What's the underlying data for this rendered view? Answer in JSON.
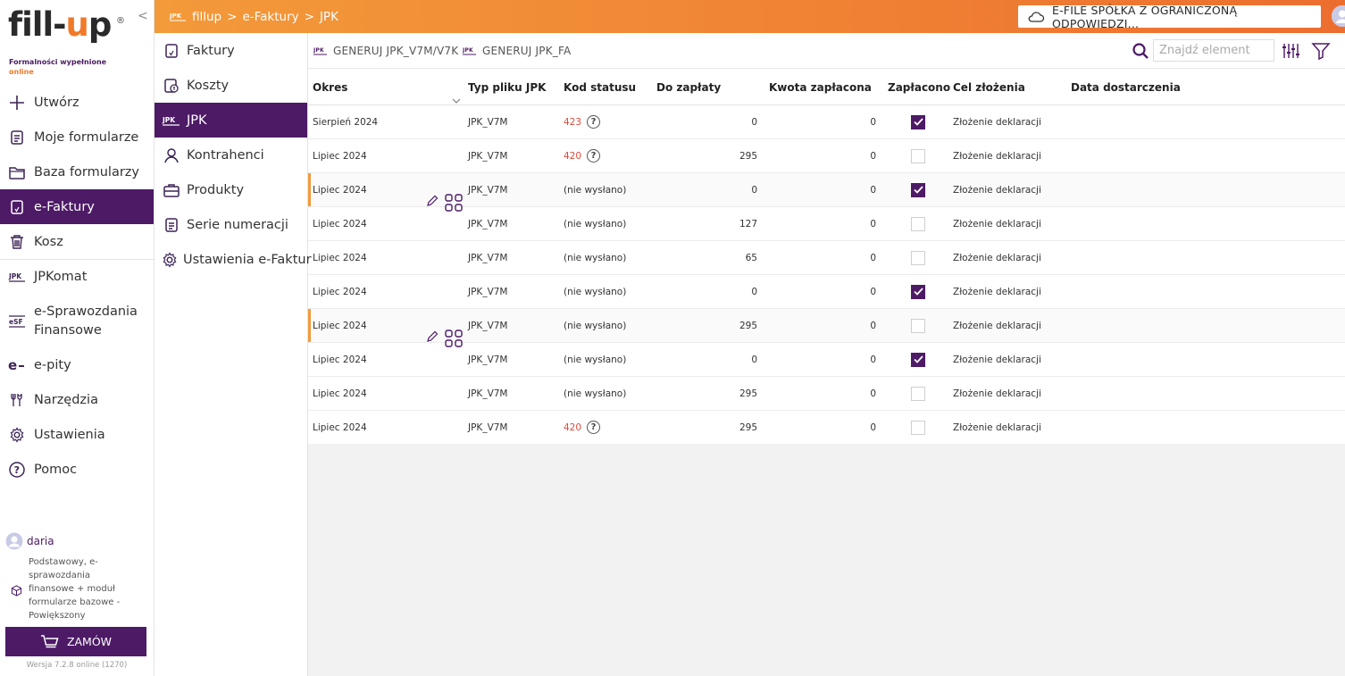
{
  "brand": {
    "logo_text_pre": "fill-",
    "logo_text_o": "u",
    "logo_text_post": "p",
    "reg": "®",
    "tagline_1": "Formalności wypełnione",
    "tagline_2": "online",
    "accent": "#f07a2a",
    "primary": "#4d1a66"
  },
  "collapse_label": "<",
  "sidebar": {
    "items": [
      {
        "label": "Utwórz",
        "icon": "plus-icon"
      },
      {
        "label": "Moje formularze",
        "icon": "document-icon"
      },
      {
        "label": "Baza formularzy",
        "icon": "folder-icon"
      },
      {
        "label": "e-Faktury",
        "icon": "invoice-icon",
        "active": true
      },
      {
        "label": "Kosz",
        "icon": "trash-icon"
      },
      {
        "label": "JPKomat",
        "icon": "jpk-icon"
      },
      {
        "label_1": "e-Sprawozdania",
        "label_2": "Finansowe",
        "icon": "esf-icon"
      },
      {
        "label": "e-pity",
        "icon": "epity-icon"
      },
      {
        "label": "Narzędzia",
        "icon": "tools-icon"
      },
      {
        "label": "Ustawienia",
        "icon": "gear-icon"
      },
      {
        "label": "Pomoc",
        "icon": "help-icon"
      }
    ]
  },
  "user": {
    "name": "daria",
    "plan": "Podstawowy, e-sprawozdania finansowe + moduł formularze bazowe - Powiększony"
  },
  "order_button": "ZAMÓW",
  "version": "Wersja 7.2.8 online (1270)",
  "topbar": {
    "crumbs": [
      "fillup",
      "e-Faktury",
      "JPK"
    ],
    "crumb_sep": ">",
    "company": "E-FILE SPÓŁKA Z OGRANICZONĄ ODPOWIEDZI..."
  },
  "submenu": [
    {
      "label": "Faktury",
      "icon": "invoice-icon"
    },
    {
      "label": "Koszty",
      "icon": "costs-icon"
    },
    {
      "label": "JPK",
      "icon": "jpk-icon",
      "active": true
    },
    {
      "label": "Kontrahenci",
      "icon": "person-icon"
    },
    {
      "label": "Produkty",
      "icon": "briefcase-icon"
    },
    {
      "label": "Serie numeracji",
      "icon": "document-icon"
    },
    {
      "label": "Ustawienia e-Faktur",
      "icon": "gear-icon"
    }
  ],
  "toolbar": {
    "gen_v7": "GENERUJ JPK_V7M/V7K",
    "gen_fa": "GENERUJ JPK_FA",
    "search_placeholder": "Znajdź element",
    "jpk_icon_label": "JPK"
  },
  "table": {
    "headers": {
      "okres": "Okres",
      "typ": "Typ pliku JPK",
      "kod": "Kod statusu",
      "do": "Do zapłaty",
      "kwota": "Kwota zapłacona",
      "zap": "Zapłacono",
      "cel": "Cel złożenia",
      "data": "Data dostarczenia"
    },
    "rows": [
      {
        "okres": "Sierpień 2024",
        "typ": "JPK_V7M",
        "kod": "423",
        "kod_err": true,
        "do": "0",
        "kwota": "0",
        "paid": true,
        "cel": "Złożenie deklaracji",
        "data": ""
      },
      {
        "okres": "Lipiec 2024",
        "typ": "JPK_V7M",
        "kod": "420",
        "kod_err": true,
        "do": "295",
        "kwota": "0",
        "paid": false,
        "cel": "Złożenie deklaracji",
        "data": ""
      },
      {
        "okres": "Lipiec 2024",
        "typ": "JPK_V7M",
        "kod": "(nie wysłano)",
        "kod_err": false,
        "do": "0",
        "kwota": "0",
        "paid": true,
        "cel": "Złożenie deklaracji",
        "data": "",
        "hover": true
      },
      {
        "okres": "Lipiec 2024",
        "typ": "JPK_V7M",
        "kod": "(nie wysłano)",
        "kod_err": false,
        "do": "127",
        "kwota": "0",
        "paid": false,
        "cel": "Złożenie deklaracji",
        "data": ""
      },
      {
        "okres": "Lipiec 2024",
        "typ": "JPK_V7M",
        "kod": "(nie wysłano)",
        "kod_err": false,
        "do": "65",
        "kwota": "0",
        "paid": false,
        "cel": "Złożenie deklaracji",
        "data": ""
      },
      {
        "okres": "Lipiec 2024",
        "typ": "JPK_V7M",
        "kod": "(nie wysłano)",
        "kod_err": false,
        "do": "0",
        "kwota": "0",
        "paid": true,
        "cel": "Złożenie deklaracji",
        "data": ""
      },
      {
        "okres": "Lipiec 2024",
        "typ": "JPK_V7M",
        "kod": "(nie wysłano)",
        "kod_err": false,
        "do": "295",
        "kwota": "0",
        "paid": false,
        "cel": "Złożenie deklaracji",
        "data": "",
        "hover": true
      },
      {
        "okres": "Lipiec 2024",
        "typ": "JPK_V7M",
        "kod": "(nie wysłano)",
        "kod_err": false,
        "do": "0",
        "kwota": "0",
        "paid": true,
        "cel": "Złożenie deklaracji",
        "data": ""
      },
      {
        "okres": "Lipiec 2024",
        "typ": "JPK_V7M",
        "kod": "(nie wysłano)",
        "kod_err": false,
        "do": "295",
        "kwota": "0",
        "paid": false,
        "cel": "Złożenie deklaracji",
        "data": ""
      },
      {
        "okres": "Lipiec 2024",
        "typ": "JPK_V7M",
        "kod": "420",
        "kod_err": true,
        "do": "295",
        "kwota": "0",
        "paid": false,
        "cel": "Złożenie deklaracji",
        "data": ""
      }
    ]
  }
}
